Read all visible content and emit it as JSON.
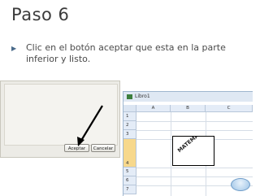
{
  "slide": {
    "title": "Paso 6",
    "bullet": "Clic en el botón aceptar que esta en la parte inferior y listo."
  },
  "dialog": {
    "ok_label": "Aceptar",
    "cancel_label": "Cancelar"
  },
  "spreadsheet": {
    "window_title": "Libro1",
    "columns": [
      "A",
      "B",
      "C"
    ],
    "rows": [
      "1",
      "2",
      "3",
      "4",
      "5",
      "6",
      "7"
    ],
    "rotated_cell_text": "MATEMATICA"
  },
  "colors": {
    "accent_selected_row": "#f7d88c",
    "header_fill": "#e4ecf7"
  }
}
